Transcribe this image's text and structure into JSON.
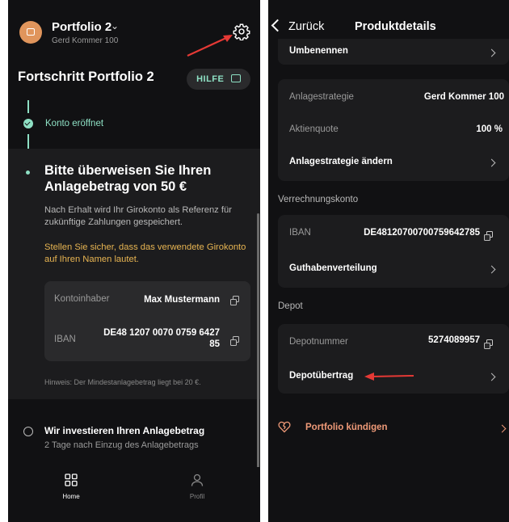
{
  "left": {
    "portfolio_name": "Portfolio 2",
    "portfolio_sub": "Gerd Kommer 100",
    "title": "Fortschritt Portfolio 2",
    "help_label": "HILFE",
    "steps": [
      {
        "label": "Konto eröffnet"
      },
      {
        "title": "Bitte überweisen Sie Ihren Anlagebetrag von 50 €",
        "description": "Nach Erhalt wird Ihr Girokonto als Referenz für zukünftige Zahlungen gespeichert.",
        "warning": "Stellen Sie sicher, dass das verwendete Girokonto auf Ihren Namen lautet.",
        "holder_label": "Kontoinhaber",
        "holder_value": "Max Mustermann",
        "iban_label": "IBAN",
        "iban_value_line1": "DE48 1207 0070 0759 6427",
        "iban_value_line2": "85",
        "hint": "Hinweis: Der Mindestanlagebetrag liegt bei 20 €."
      },
      {
        "title": "Wir investieren Ihren Anlagebetrag",
        "subtitle": "2 Tage nach Einzug des Anlagebetrags"
      }
    ],
    "tabs": [
      {
        "label": "Home",
        "icon": "grid-icon"
      },
      {
        "label": "Profil",
        "icon": "person-icon"
      }
    ]
  },
  "right": {
    "back_label": "Zurück",
    "title": "Produktdetails",
    "rename_label": "Umbenennen",
    "strategy_label": "Anlagestrategie",
    "strategy_value": "Gerd Kommer 100",
    "equity_label": "Aktienquote",
    "equity_value": "100 %",
    "change_strategy_label": "Anlagestrategie ändern",
    "clearing_heading": "Verrechnungskonto",
    "iban_label": "IBAN",
    "iban_value": "DE48120700700759642785",
    "balance_label": "Guthabenverteilung",
    "depot_heading": "Depot",
    "depot_number_label": "Depotnummer",
    "depot_number_value": "5274089957",
    "depot_transfer_label": "Depotübertrag",
    "cancel_label": "Portfolio kündigen"
  },
  "colors": {
    "accent": "#8ee0c4",
    "warning": "#e8b552",
    "danger": "#ef9a78",
    "annotation_arrow": "#e53935",
    "avatar": "#e0955c"
  }
}
